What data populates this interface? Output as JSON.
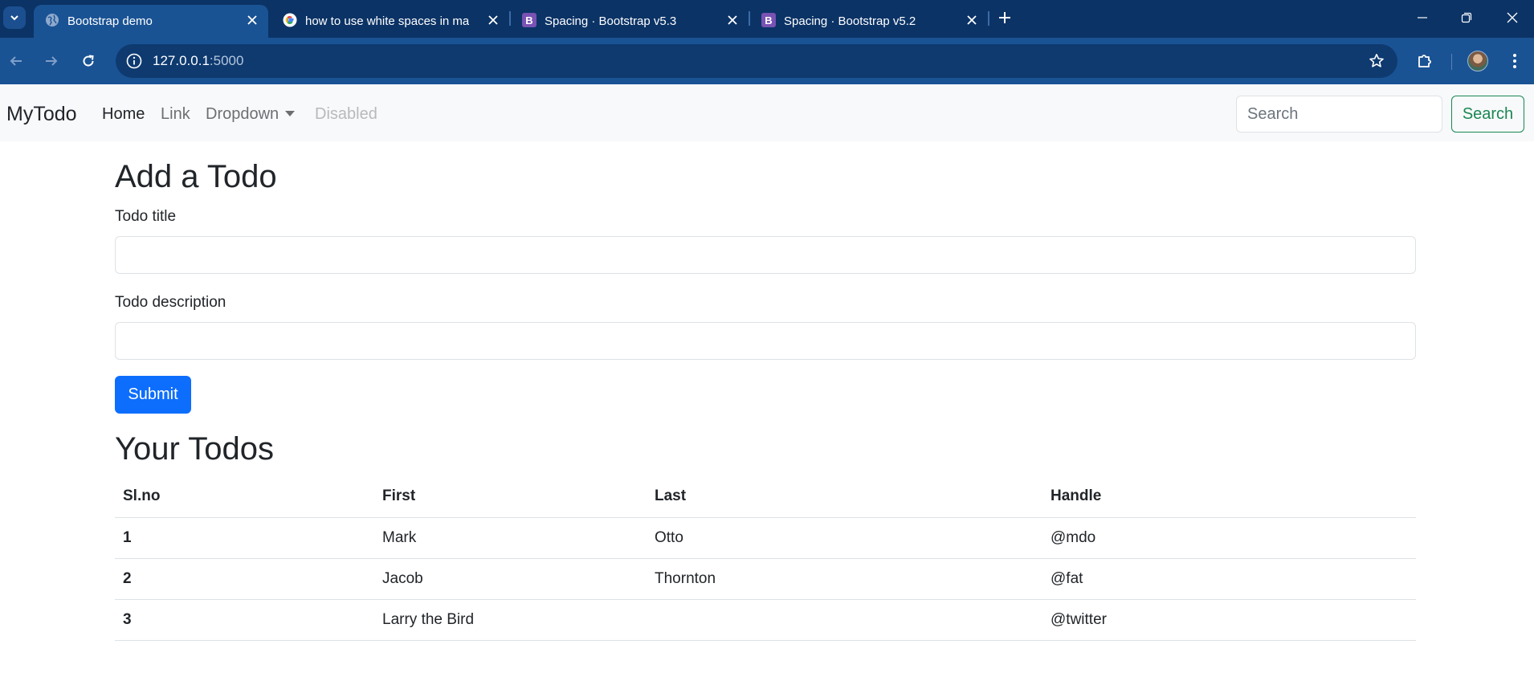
{
  "browser": {
    "tabs": [
      {
        "title": "Bootstrap demo",
        "favicon": "globe-icon",
        "active": true
      },
      {
        "title": "how to use white spaces in mar",
        "favicon": "google-icon",
        "active": false
      },
      {
        "title": "Spacing · Bootstrap v5.3",
        "favicon": "bootstrap-icon",
        "active": false
      },
      {
        "title": "Spacing · Bootstrap v5.2",
        "favicon": "bootstrap-icon",
        "active": false
      }
    ],
    "url_host": "127.0.0.1",
    "url_port": ":5000",
    "colors": {
      "tabstrip": "#0b3366",
      "toolbar": "#1a5394",
      "omnibox": "#0e3a70",
      "bootstrap_purple": "#7952b3"
    }
  },
  "navbar": {
    "brand": "MyTodo",
    "links": [
      {
        "label": "Home",
        "state": "active"
      },
      {
        "label": "Link",
        "state": "normal"
      },
      {
        "label": "Dropdown",
        "state": "dropdown"
      },
      {
        "label": "Disabled",
        "state": "disabled"
      }
    ],
    "search_placeholder": "Search",
    "search_button": "Search",
    "colors": {
      "outline_success": "#198754"
    }
  },
  "form": {
    "heading": "Add a Todo",
    "title_label": "Todo title",
    "title_value": "",
    "description_label": "Todo description",
    "description_value": "",
    "submit_label": "Submit",
    "colors": {
      "primary": "#0d6efd"
    }
  },
  "todos": {
    "heading": "Your Todos",
    "columns": [
      "Sl.no",
      "First",
      "Last",
      "Handle"
    ],
    "rows": [
      [
        "1",
        "Mark",
        "Otto",
        "@mdo"
      ],
      [
        "2",
        "Jacob",
        "Thornton",
        "@fat"
      ],
      [
        "3",
        "Larry the Bird",
        "",
        "@twitter"
      ]
    ]
  }
}
